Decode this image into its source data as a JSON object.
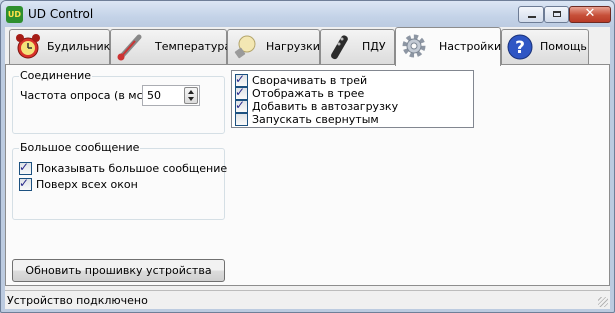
{
  "window": {
    "title": "UD Control",
    "app_icon": "UD",
    "close_glyph": "✕"
  },
  "tabs": [
    {
      "label": "Будильник",
      "icon": "alarm-clock-icon"
    },
    {
      "label": "Температура",
      "icon": "thermometer-icon"
    },
    {
      "label": "Нагрузки",
      "icon": "light-bulb-icon"
    },
    {
      "label": "ПДУ",
      "icon": "remote-control-icon"
    },
    {
      "label": "Настройки",
      "icon": "gear-icon",
      "active": true
    },
    {
      "label": "Помощь",
      "icon": "help-icon"
    }
  ],
  "connection": {
    "title": "Соединение",
    "poll_label": "Частота опроса (в мс):",
    "poll_value": "50"
  },
  "big_message": {
    "title": "Большое сообщение",
    "show_label": "Показывать большое сообщение",
    "show_checked": true,
    "ontop_label": "Поверх всех окон",
    "ontop_checked": true
  },
  "tray": {
    "minimize_label": "Сворачивать в трей",
    "minimize_checked": true,
    "show_label": "Отображать в трее",
    "show_checked": true,
    "autostart_label": "Добавить в автозагрузку",
    "autostart_checked": true,
    "start_min_label": "Запускать свернутым",
    "start_min_checked": false
  },
  "firmware_button": "Обновить прошивку устройства",
  "status": "Устройство подключено",
  "check_glyph": "✓"
}
